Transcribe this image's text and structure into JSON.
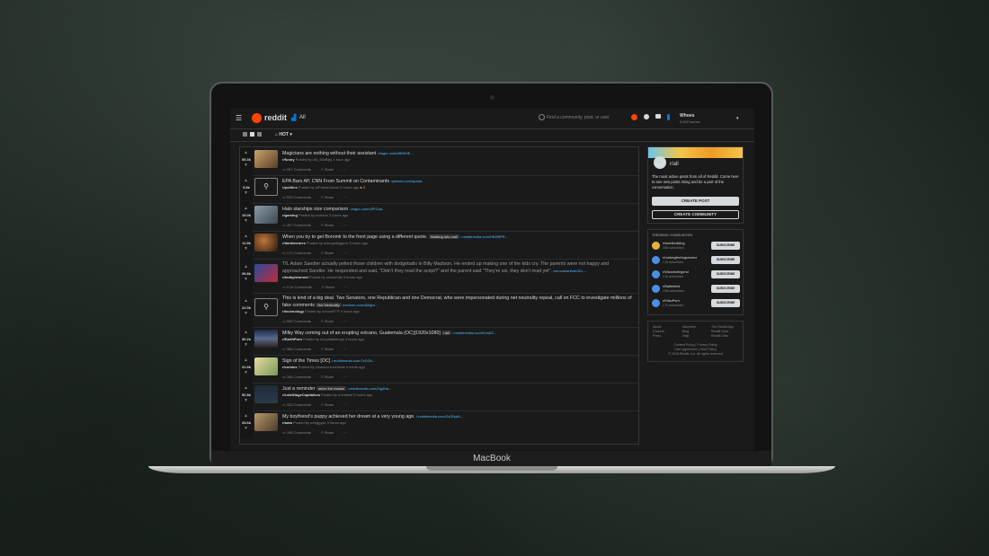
{
  "device": {
    "brand": "MacBook"
  },
  "header": {
    "logo_text": "reddit",
    "feed": "All",
    "search_placeholder": "Find a community, post, or user",
    "username": "Whoes",
    "karma": "5,692 karma",
    "sort": "HOT"
  },
  "posts": [
    {
      "score": "59.3k",
      "title": "Magicians are nothing without their assistant",
      "domain": "i.imgur.com/dBWKfE...",
      "subreddit": "r/funny",
      "meta": "Posted by u/4_30dB(s) 1 hour ago",
      "comments": "287 Comments",
      "share": "Share"
    },
    {
      "score": "9.8k",
      "title": "EPA Bars AP, CNN From Summit on Contaminants",
      "domain": "nytimes.com/apand...",
      "subreddit": "r/politics",
      "meta": "Posted by u/PowerCamel 3 hours ago",
      "comments": "939 Comments",
      "share": "Share",
      "badge": "2"
    },
    {
      "score": "15.0k",
      "title": "Halo starships size comparison",
      "domain": "i.imgur.com/uZFGub...",
      "subreddit": "r/gaming",
      "meta": "Posted by u/obezo 3 hours ago",
      "comments": "497 Comments",
      "share": "Share"
    },
    {
      "score": "11.9k",
      "title": "When you try to get Boromir to the front page using a different quote.",
      "flair": "Walking into mall",
      "domain": "i.redditmedia.com/HBDBPR...",
      "subreddit": "r/dankmemes",
      "meta": "Posted by u/longstleggers 3 hours ago",
      "comments": "174 Comments",
      "share": "Share"
    },
    {
      "score": "39.8k",
      "title": "TIL Adam Sandler actually pelted those children with dodgeballs in Billy Madison. He ended up making one of the kids cry. The parents were not happy and approached Sandler. He responded and said, \"Didn't they read the script?\" and the parent said \"They're six, they don't read yet\".",
      "domain": "ew.com/article/201...",
      "subreddit": "r/todayilearned",
      "meta": "Posted by u/mwerski 3 hours ago",
      "comments": "2.2k Comments",
      "share": "Share"
    },
    {
      "score": "22.5k",
      "title": "This is kind of a big deal. Two Senators, one Republican and one Democrat, who were impersonated during net neutrality repeal, call on FCC to investigate millions of fake comments",
      "flair": "Net Neutrality",
      "domain": "medium.com/@fight...",
      "subreddit": "r/technology",
      "meta": "Posted by u/evanFTP 4 hours ago",
      "comments": "580 Comments",
      "share": "Share"
    },
    {
      "score": "30.2k",
      "title": "Milky Way coming out of an erupting volcano, Guatemala (OC)[1920x1080]",
      "flair": "r/all",
      "domain": "i.redditmedia.com/rKcs53...",
      "subreddit": "r/EarthPorn",
      "meta": "Posted by u/crystalbeings 4 hours ago",
      "comments": "366 Comments",
      "share": "Share"
    },
    {
      "score": "31.9k",
      "title": "Sign of the Times [OC]",
      "domain": "i.redditmedia.com/7zDGb...",
      "subreddit": "r/comics",
      "meta": "Posted by u/comiccomicfreak 4 hours ago",
      "comments": "266 Comments",
      "share": "Share"
    },
    {
      "score": "50.8k",
      "title": "Just a reminder",
      "flair": "seize the means",
      "domain": "i.redditmedia.com/Zqj4Ha...",
      "subreddit": "r/LateStageCapitalism",
      "meta": "Posted by u/vriskerl 3 hours ago",
      "comments": "320 Comments",
      "share": "Share"
    },
    {
      "score": "33.6k",
      "title": "My boyfriend's puppy achieved her dream at a very young age.",
      "domain": "i.redditmedia.com/ZxGNyM...",
      "subreddit": "r/aww",
      "meta": "Posted by u/reggyzz 3 hours ago",
      "comments": "196 Comments",
      "share": "Share"
    }
  ],
  "sidebar": {
    "name": "r/all",
    "desc": "The most active posts from all of Reddit. Come here to see new posts rising and be a part of the conversation.",
    "create_post": "CREATE POST",
    "create_community": "CREATE COMMUNITY",
    "trending_title": "TRENDING COMMUNITIES",
    "communities": [
      {
        "name": "r/worldbuilding",
        "subs": "164k subscribers",
        "btn": "SUBSCRIBE"
      },
      {
        "name": "r/rankingfeelingsinnerz",
        "subs": "1.2k subscribers",
        "btn": "SUBSCRIBE"
      },
      {
        "name": "r/Wizardoflegend",
        "subs": "2.3k subscribers",
        "btn": "SUBSCRIBE"
      },
      {
        "name": "r/Battlefield",
        "subs": "135k subscribers",
        "btn": "SUBSCRIBE"
      },
      {
        "name": "r/KitsuPorn",
        "subs": "1.7k subscribers",
        "btn": "SUBSCRIBE"
      }
    ],
    "footer": {
      "col1": [
        "About",
        "Careers",
        "Press"
      ],
      "col2": [
        "Advertise",
        "Blog",
        "Help"
      ],
      "col3": [
        "The Reddit App",
        "Reddit Gold",
        "Reddit Gifts"
      ],
      "line1": "Content Policy | Privacy Policy",
      "line2": "User Agreement | Mod Policy",
      "copyright": "© 2018 Reddit, Inc. All rights reserved"
    }
  }
}
